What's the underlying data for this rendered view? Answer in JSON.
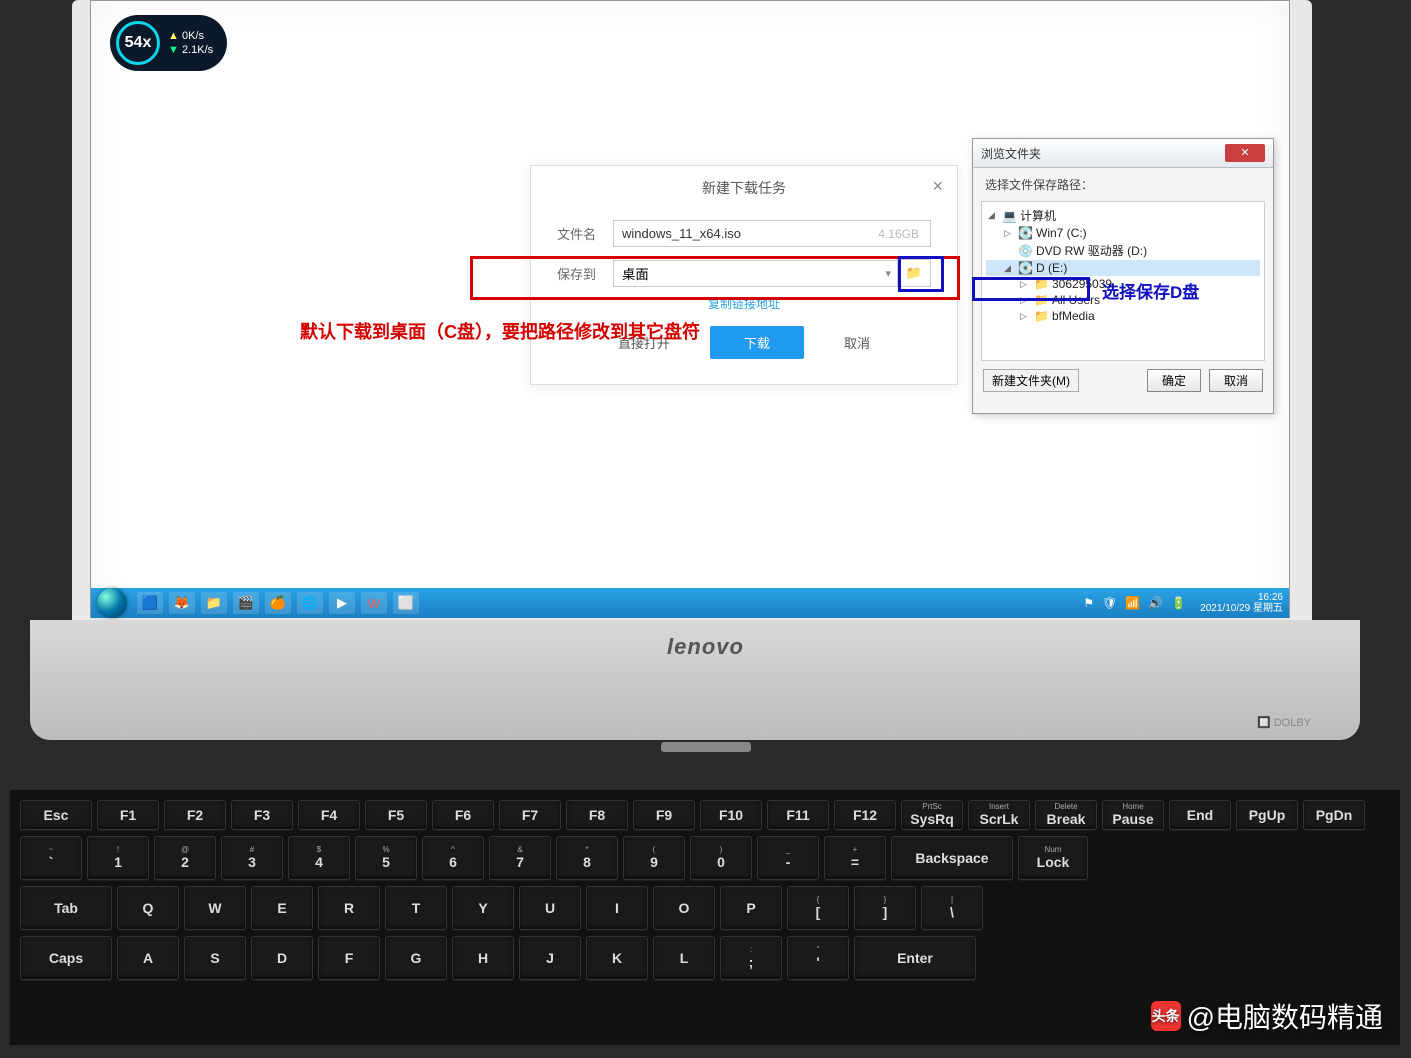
{
  "speed": {
    "value": "54x",
    "up": "0K/s",
    "down": "2.1K/s"
  },
  "download_dialog": {
    "title": "新建下载任务",
    "filename_label": "文件名",
    "filename": "windows_11_x64.iso",
    "filesize": "4.16GB",
    "saveto_label": "保存到",
    "saveto_value": "桌面",
    "copy_link": "复制链接地址",
    "open_btn": "直接打开",
    "download_btn": "下载",
    "cancel_btn": "取消"
  },
  "annotations": {
    "red_text": "默认下载到桌面（C盘），要把路径修改到其它盘符",
    "blue_text": "选择保存D盘"
  },
  "browse_dialog": {
    "title": "浏览文件夹",
    "subtitle": "选择文件保存路径：",
    "tree": {
      "computer": "计算机",
      "win7": "Win7 (C:)",
      "dvd": "DVD RW 驱动器 (D:)",
      "d_drive": "D (E:)",
      "folder1": "306295039",
      "folder2": "All Users",
      "folder3": "bfMedia"
    },
    "new_folder": "新建文件夹(M)",
    "ok": "确定",
    "cancel": "取消"
  },
  "taskbar": {
    "time": "16:26",
    "date": "2021/10/29 星期五"
  },
  "laptop": {
    "brand": "lenovo",
    "dolby": "DOLBY"
  },
  "keyboard": {
    "fn": [
      "Esc",
      "F1",
      "F2",
      "F3",
      "F4",
      "F5",
      "F6",
      "F7",
      "F8",
      "F9",
      "F10",
      "F11",
      "F12",
      "PrtSc\nSysRq",
      "Insert\nScrLk",
      "Delete\nBreak",
      "Home\nPause",
      "End",
      "PgUp",
      "PgDn"
    ],
    "row2_special": [
      "Num\nLock"
    ],
    "row1": [
      "~\n`",
      "!\n1",
      "@\n2",
      "#\n3",
      "$\n4",
      "%\n5",
      "^\n6",
      "&\n7",
      "*\n8",
      "(\n9",
      ")\n0",
      "_\n-",
      "+\n=",
      "Backspace"
    ],
    "row2": [
      "Tab",
      "Q",
      "W",
      "E",
      "R",
      "T",
      "Y",
      "U",
      "I",
      "O",
      "P",
      "{\n[",
      "}\n]",
      "|\n\\"
    ],
    "row3": [
      "Caps",
      "A",
      "S",
      "D",
      "F",
      "G",
      "H",
      "J",
      "K",
      "L",
      ":\n;",
      "\"\n'",
      "Enter"
    ]
  },
  "watermark": {
    "logo": "头条",
    "text": "@电脑数码精通"
  }
}
